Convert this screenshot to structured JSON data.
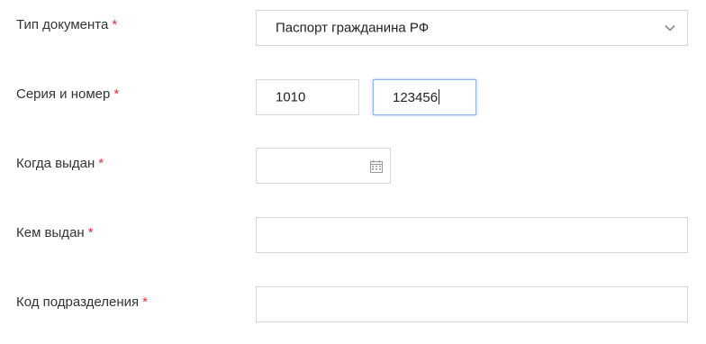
{
  "form": {
    "doc_type": {
      "label": "Тип документа",
      "required_mark": "*",
      "value": "Паспорт гражданина РФ",
      "icon": "chevron-down-icon"
    },
    "series_number": {
      "label": "Серия и номер",
      "required_mark": "*",
      "series_value": "1010",
      "number_value": "123456"
    },
    "issue_date": {
      "label": "Когда выдан",
      "required_mark": "*",
      "value": "",
      "icon": "calendar-icon"
    },
    "issued_by": {
      "label": "Кем выдан",
      "required_mark": "*",
      "value": ""
    },
    "division_code": {
      "label": "Код подразделения",
      "required_mark": "*",
      "value": ""
    }
  },
  "colors": {
    "required": "#e2303a",
    "border": "#d7d7d7",
    "focus_border": "#8fb4ea"
  }
}
